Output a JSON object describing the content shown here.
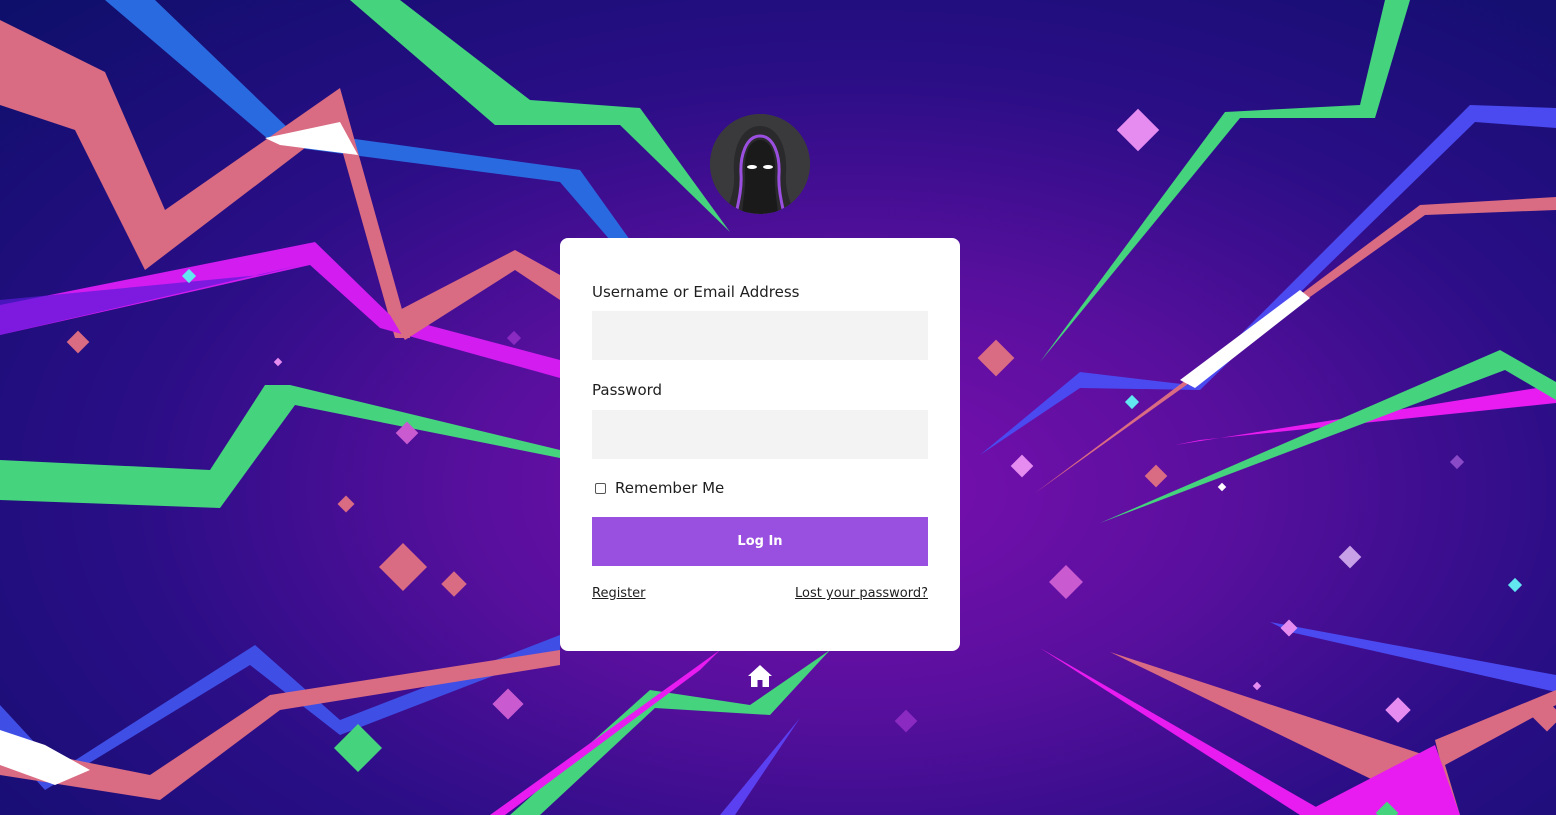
{
  "login": {
    "username_label": "Username or Email Address",
    "username_value": "",
    "password_label": "Password",
    "password_value": "",
    "remember_label": "Remember Me",
    "remember_checked": false,
    "submit_label": "Log In",
    "register_link": "Register",
    "lost_password_link": "Lost your password?"
  },
  "icons": {
    "logo": "hooded-figure-icon",
    "home": "home-icon"
  },
  "colors": {
    "button": "#9950e0",
    "card": "#ffffff",
    "field": "#f3f3f3",
    "background_center": "#7a0fb0",
    "background_edge": "#0d0f6a"
  }
}
